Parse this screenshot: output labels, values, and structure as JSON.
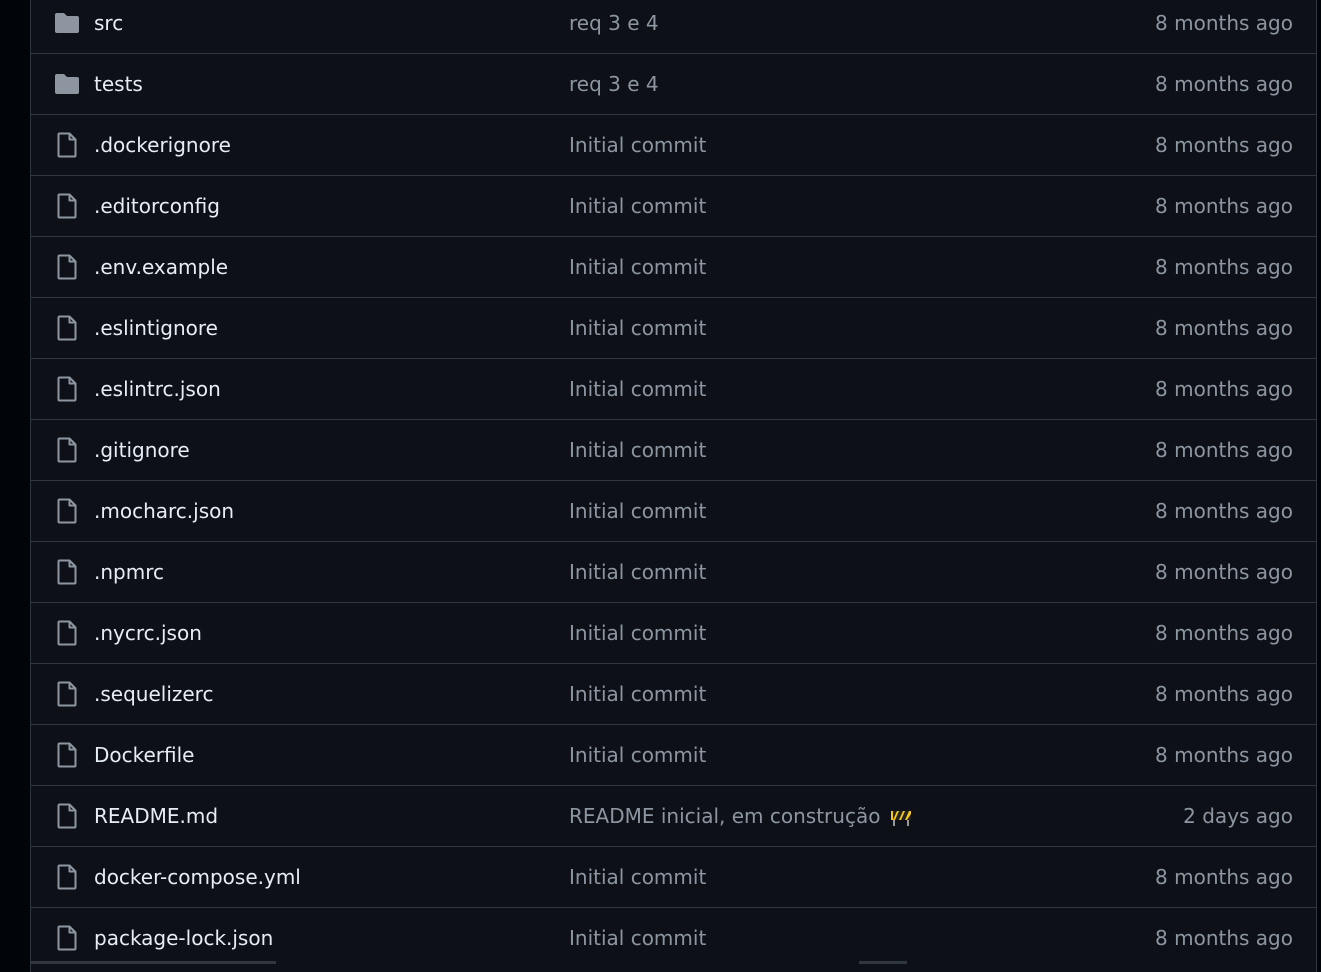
{
  "files": [
    {
      "type": "folder",
      "name": "src",
      "commit": "req 3 e 4",
      "age": "8 months ago"
    },
    {
      "type": "folder",
      "name": "tests",
      "commit": "req 3 e 4",
      "age": "8 months ago"
    },
    {
      "type": "file",
      "name": ".dockerignore",
      "commit": "Initial commit",
      "age": "8 months ago"
    },
    {
      "type": "file",
      "name": ".editorconfig",
      "commit": "Initial commit",
      "age": "8 months ago"
    },
    {
      "type": "file",
      "name": ".env.example",
      "commit": "Initial commit",
      "age": "8 months ago"
    },
    {
      "type": "file",
      "name": ".eslintignore",
      "commit": "Initial commit",
      "age": "8 months ago"
    },
    {
      "type": "file",
      "name": ".eslintrc.json",
      "commit": "Initial commit",
      "age": "8 months ago"
    },
    {
      "type": "file",
      "name": ".gitignore",
      "commit": "Initial commit",
      "age": "8 months ago"
    },
    {
      "type": "file",
      "name": ".mocharc.json",
      "commit": "Initial commit",
      "age": "8 months ago"
    },
    {
      "type": "file",
      "name": ".npmrc",
      "commit": "Initial commit",
      "age": "8 months ago"
    },
    {
      "type": "file",
      "name": ".nycrc.json",
      "commit": "Initial commit",
      "age": "8 months ago"
    },
    {
      "type": "file",
      "name": ".sequelizerc",
      "commit": "Initial commit",
      "age": "8 months ago"
    },
    {
      "type": "file",
      "name": "Dockerfile",
      "commit": "Initial commit",
      "age": "8 months ago"
    },
    {
      "type": "file",
      "name": "README.md",
      "commit": "README inicial, em construção",
      "commit_emoji": "construction-icon",
      "age": "2 days ago"
    },
    {
      "type": "file",
      "name": "docker-compose.yml",
      "commit": "Initial commit",
      "age": "8 months ago"
    },
    {
      "type": "file",
      "name": "package-lock.json",
      "commit": "Initial commit",
      "age": "8 months ago"
    }
  ],
  "colors": {
    "page_bg": "#010409",
    "table_bg": "#0d1117",
    "border": "#30363d",
    "name_text": "#e6edf3",
    "muted_text": "#8d96a0",
    "icon": "#8d96a0"
  }
}
